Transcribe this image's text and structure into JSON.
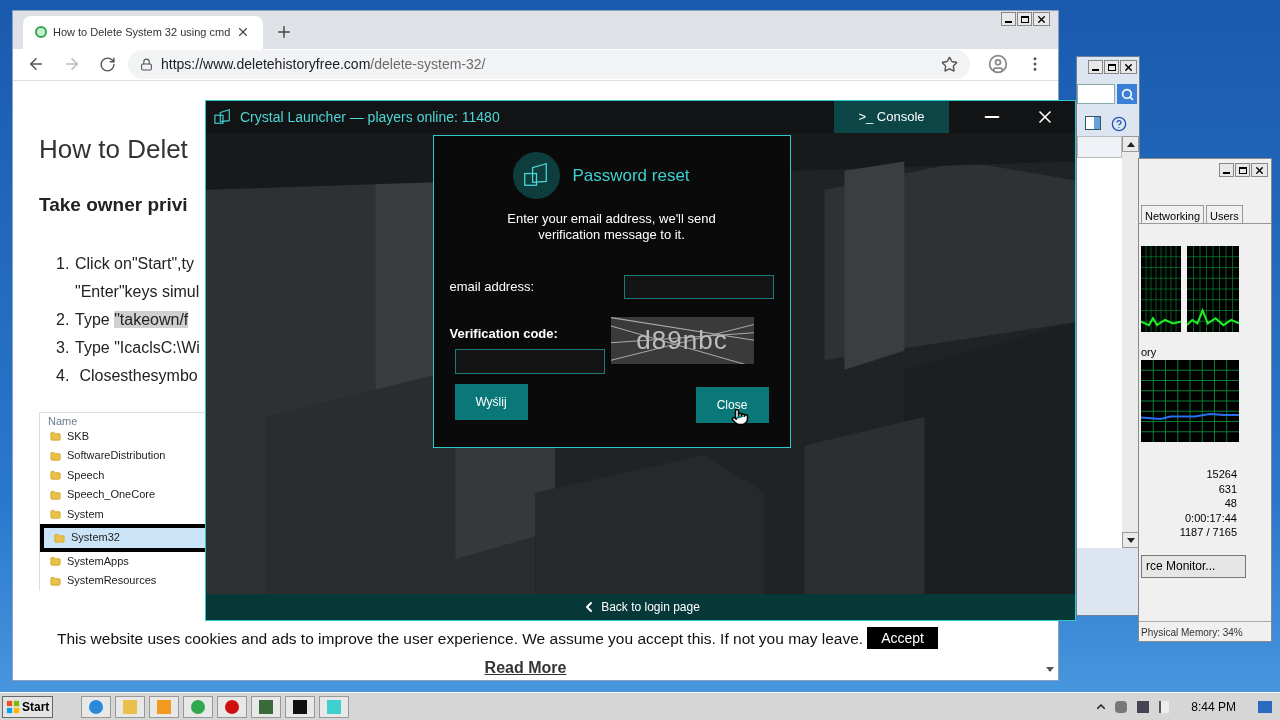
{
  "browser": {
    "tab_title": "How to Delete System 32 using cmd",
    "url_host": "https://www.deletehistoryfree.com",
    "url_path": "/delete-system-32/"
  },
  "article": {
    "heading": "How to Delet",
    "subheading": "Take owner privi",
    "steps": [
      {
        "number": "1.",
        "lines": [
          "Click on\"Start\",ty",
          "\"Enter\"keys simul"
        ]
      },
      {
        "number": "2.",
        "lines": [
          "Type "
        ],
        "highlight": "\"takeown/f"
      },
      {
        "number": "3.",
        "lines": [
          "Type \"IcaclsC:\\Wi"
        ]
      },
      {
        "number": "4.",
        "lines": [
          " Closesthesymbo"
        ]
      }
    ]
  },
  "folder_list": {
    "header": "Name",
    "rows": [
      {
        "name": "SKB",
        "selected": false
      },
      {
        "name": "SoftwareDistribution",
        "selected": false
      },
      {
        "name": "Speech",
        "selected": false
      },
      {
        "name": "Speech_OneCore",
        "selected": false
      },
      {
        "name": "System",
        "selected": false
      },
      {
        "name": "System32",
        "selected": true
      },
      {
        "name": "SystemApps",
        "selected": false
      },
      {
        "name": "SystemResources",
        "selected": false
      }
    ]
  },
  "cookie": {
    "text": "This website uses cookies and ads to improve the user experience. We assume you accept this. If not you may leave.",
    "accept": "Accept",
    "read_more": "Read More"
  },
  "launcher": {
    "title": "Crystal Launcher — players online: 11480",
    "console": ">_ Console",
    "dialog": {
      "title": "Password reset",
      "description": "Enter your email address, we'll send verification message to it.",
      "email_label": "email address:",
      "code_label": "Verification code:",
      "captcha": "d89nbc",
      "buttons": [
        {
          "label": "Wyślij"
        },
        {
          "label": "Close"
        }
      ]
    },
    "back": "Back to login page"
  },
  "task_manager": {
    "tabs": [
      {
        "label": "Networking",
        "selected": false
      },
      {
        "label": "Users",
        "selected": false
      }
    ],
    "memory_label": "ory",
    "values": [
      "15264",
      "631",
      "48",
      "0:00:17:44",
      "1187 / 7165"
    ],
    "monitor_button": "rce Monitor...",
    "status": "Physical Memory: 34%"
  },
  "taskbar": {
    "start": "Start",
    "clock": "8:44 PM"
  }
}
